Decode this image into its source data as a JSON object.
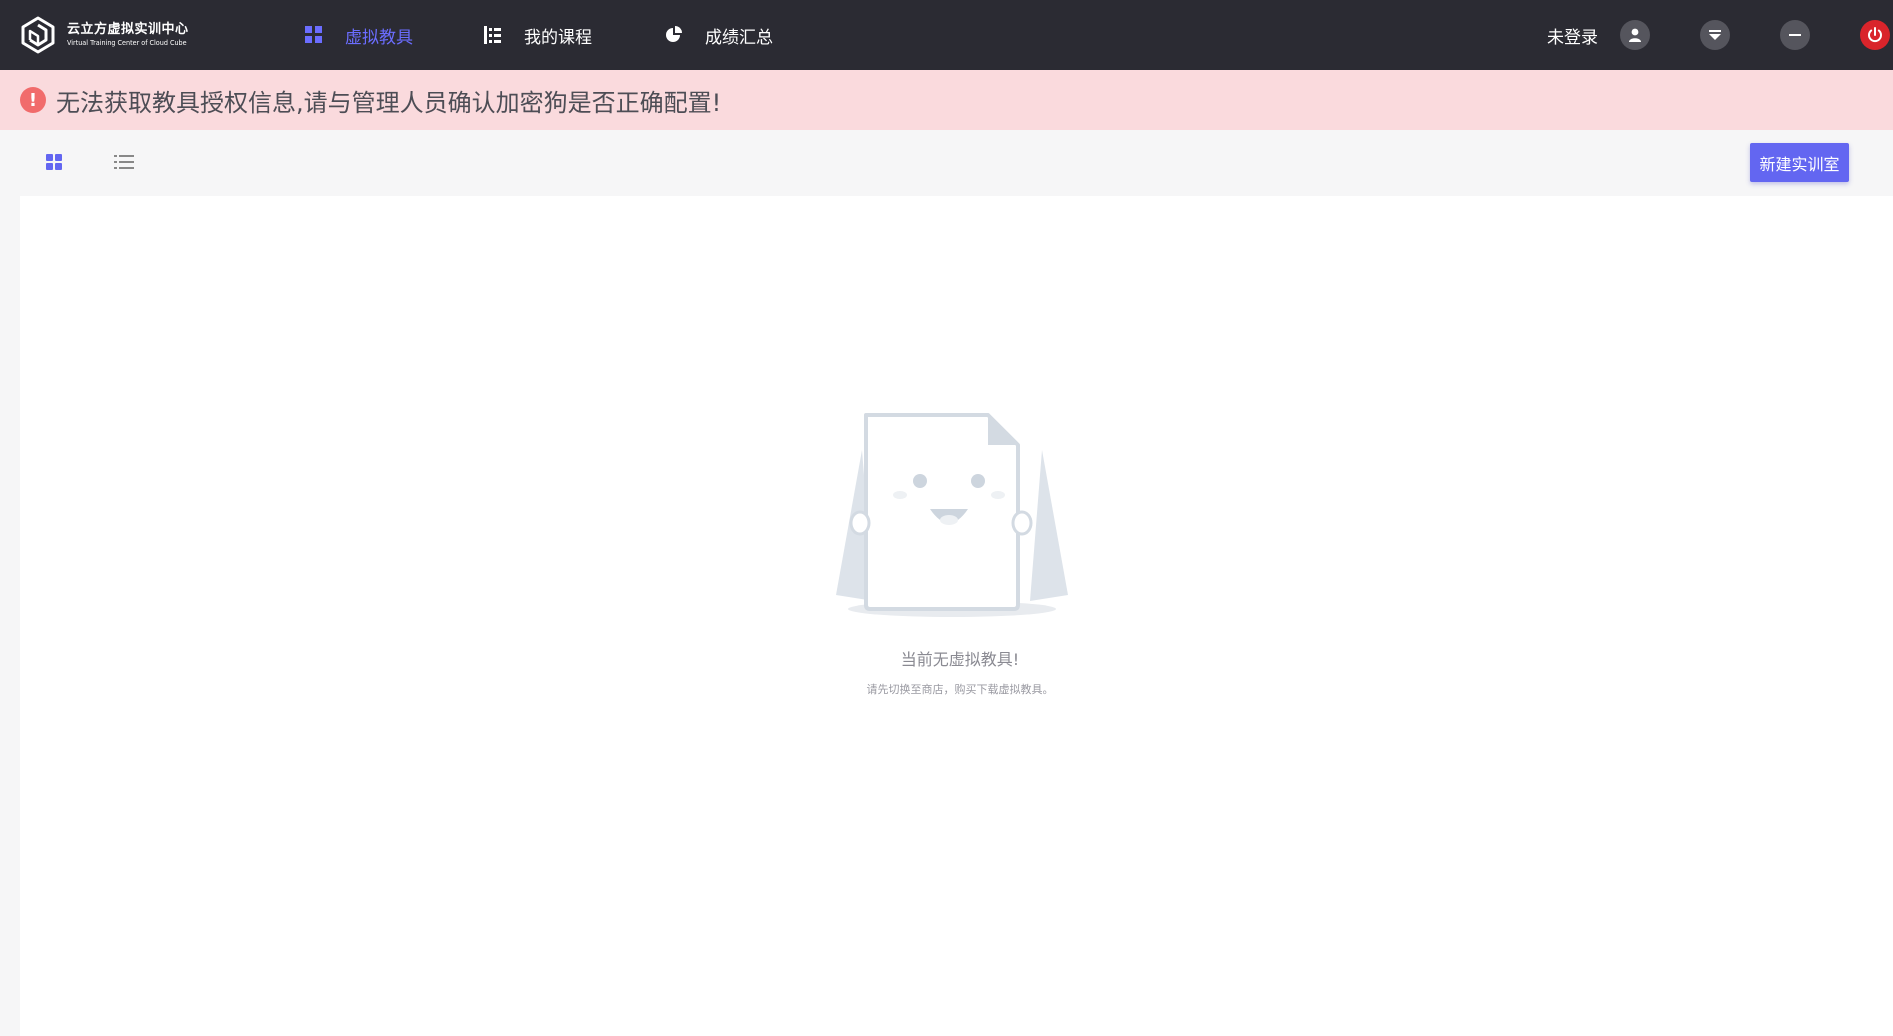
{
  "app": {
    "title": "云立方虚拟实训中心",
    "subtitle": "Virtual Training Center of Cloud Cube"
  },
  "nav": {
    "items": [
      {
        "label": "虚拟教具",
        "icon": "grid-icon",
        "active": true
      },
      {
        "label": "我的课程",
        "icon": "course-tree-icon",
        "active": false
      },
      {
        "label": "成绩汇总",
        "icon": "pie-chart-icon",
        "active": false
      }
    ]
  },
  "header_right": {
    "login_label": "未登录",
    "icons": [
      "user-icon",
      "dropdown-icon",
      "minimize-icon",
      "power-icon"
    ]
  },
  "alert": {
    "icon": "exclamation-icon",
    "message": "无法获取教具授权信息,请与管理人员确认加密狗是否正确配置!"
  },
  "toolbar": {
    "view_modes": [
      "grid-view-icon",
      "list-view-icon"
    ],
    "active_view": "grid",
    "new_button_label": "新建实训室"
  },
  "empty_state": {
    "title": "当前无虚拟教具!",
    "subtitle": "请先切换至商店，购买下载虚拟教具。"
  },
  "colors": {
    "topbar": "#2b2b33",
    "accent": "#6366f1",
    "alert_bg": "#fadadd",
    "alert_icon": "#f16b6b",
    "power": "#d9242b"
  }
}
